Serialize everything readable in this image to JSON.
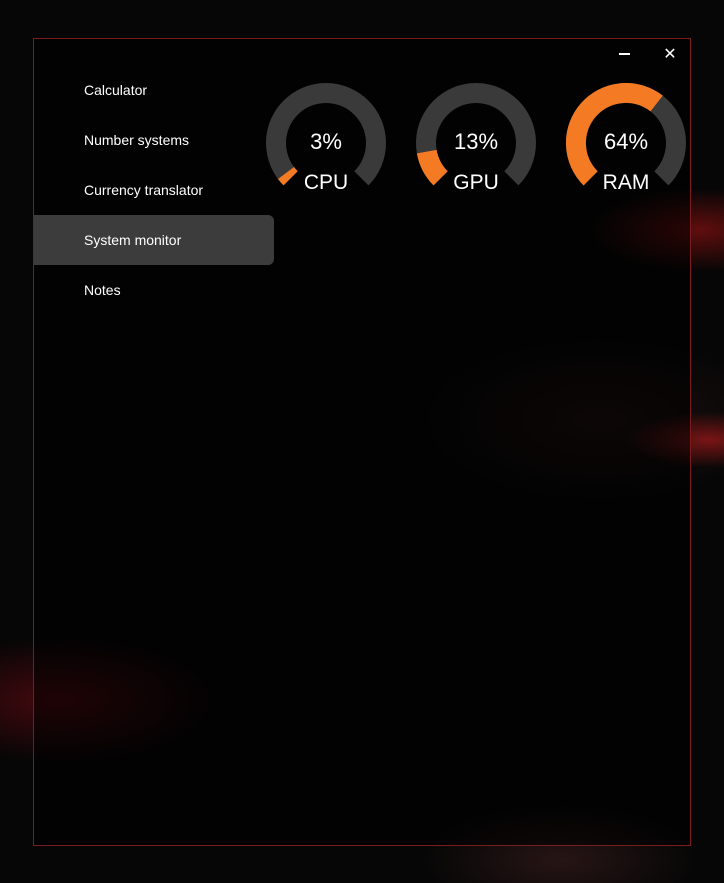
{
  "window": {
    "minimize_icon": "minimize-icon",
    "close_icon": "close-icon",
    "close_glyph": "✕",
    "border_color": "#7a1c1c"
  },
  "nav": {
    "items": [
      {
        "label": "Calculator"
      },
      {
        "label": "Number systems"
      },
      {
        "label": "Currency translator"
      },
      {
        "label": "System monitor",
        "active": true
      },
      {
        "label": "Notes"
      }
    ]
  },
  "monitor": {
    "gauges": [
      {
        "name": "CPU",
        "value_text": "3%",
        "percent": 3
      },
      {
        "name": "GPU",
        "value_text": "13%",
        "percent": 13
      },
      {
        "name": "RAM",
        "value_text": "64%",
        "percent": 64
      }
    ],
    "colors": {
      "track": "#3a3a3a",
      "fill": "#f47a24"
    }
  }
}
